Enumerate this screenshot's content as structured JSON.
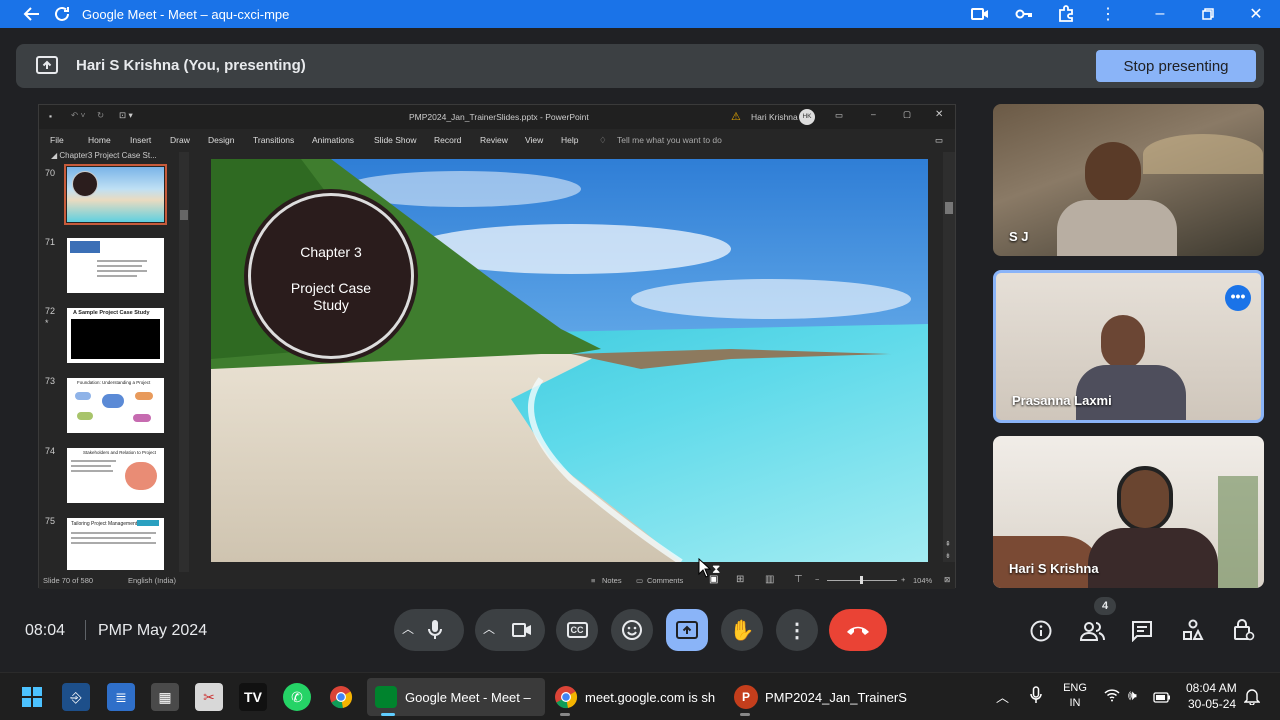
{
  "window": {
    "title": "Google Meet - Meet – aqu-cxci-mpe"
  },
  "banner": {
    "presenter": "Hari S Krishna (You, presenting)",
    "stop_label": "Stop presenting"
  },
  "ppt": {
    "file_title": "PMP2024_Jan_TrainerSlides.pptx  -  PowerPoint",
    "user": "Hari Krishna",
    "user_initials": "HK",
    "menu": [
      "File",
      "Home",
      "Insert",
      "Draw",
      "Design",
      "Transitions",
      "Animations",
      "Slide Show",
      "Record",
      "Review",
      "View",
      "Help"
    ],
    "tell_me": "Tell me what you want to do",
    "section": "Chapter3 Project Case St...",
    "slide_numbers": [
      "70",
      "71",
      "72",
      "73",
      "74",
      "75"
    ],
    "thumb_titles": {
      "t72": "A Sample Project Case Study",
      "t73": "Foundation: Understanding a Project",
      "t74": "Stakeholders and Relation to Project",
      "t75": "Tailoring Project Management"
    },
    "slide": {
      "line1": "Chapter 3",
      "line2": "Project Case",
      "line3": "Study"
    },
    "status": {
      "slide_pos": "Slide 70 of 580",
      "language": "English (India)",
      "notes": "Notes",
      "comments": "Comments",
      "zoom": "104%"
    }
  },
  "tiles": [
    {
      "name": "S J"
    },
    {
      "name": "Prasanna Laxmi"
    },
    {
      "name": "Hari S Krishna"
    }
  ],
  "meeting": {
    "time": "08:04",
    "title": "PMP May 2024",
    "people_count": "4"
  },
  "taskbar": {
    "apps": [
      "Google Meet - Meet –",
      "meet.google.com is sh",
      "PMP2024_Jan_TrainerS"
    ],
    "lang1": "ENG",
    "lang2": "IN",
    "clock_time": "08:04 AM",
    "clock_date": "30-05-24"
  },
  "colors": {
    "accent": "#1a73e8",
    "stop_btn": "#8ab4f8",
    "end_call": "#ea4335",
    "present_active": "#8ab4f8"
  }
}
